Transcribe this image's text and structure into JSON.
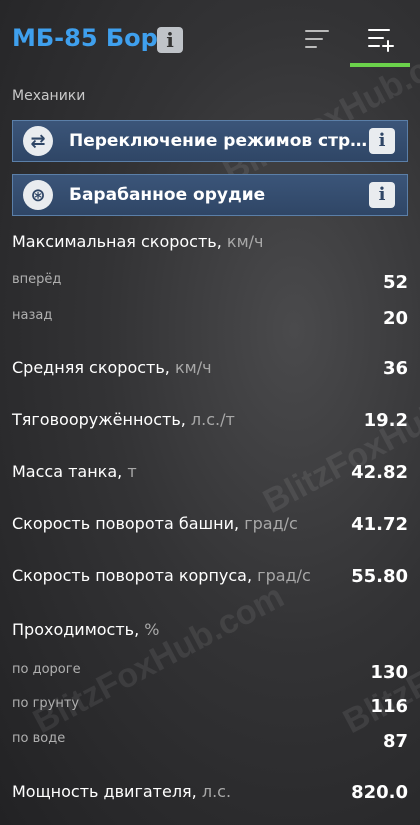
{
  "header": {
    "tank_name": "МБ-85 Бор",
    "info_glyph": "i"
  },
  "watermarks": {
    "text": "BlitzFoxHub.com"
  },
  "section": {
    "mechanics_label": "Механики"
  },
  "mechanics": [
    {
      "label": "Переключение режимов стр...",
      "icon": "mode-switch-icon",
      "info": "i"
    },
    {
      "label": "Барабанное орудие",
      "icon": "drum-gun-icon",
      "info": "i"
    }
  ],
  "stats": {
    "max_speed": {
      "label": "Максимальная скорость,",
      "unit": "км/ч"
    },
    "forward": {
      "label": "вперёд",
      "value": "52"
    },
    "reverse": {
      "label": "назад",
      "value": "20"
    },
    "avg_speed": {
      "label": "Средняя скорость,",
      "unit": "км/ч",
      "value": "36"
    },
    "power_ratio": {
      "label": "Тяговооружённость,",
      "unit": "л.с./т",
      "value": "19.2"
    },
    "mass": {
      "label": "Масса танка,",
      "unit": "т",
      "value": "42.82"
    },
    "turret_traverse": {
      "label": "Скорость поворота башни,",
      "unit": "град/с",
      "value": "41.72"
    },
    "hull_traverse": {
      "label": "Скорость поворота корпуса,",
      "unit": "град/с",
      "value": "55.80"
    },
    "terrain": {
      "label": "Проходимость,",
      "unit": "%"
    },
    "road": {
      "label": "по дороге",
      "value": "130"
    },
    "soil": {
      "label": "по грунту",
      "value": "116"
    },
    "water": {
      "label": "по воде",
      "value": "87"
    },
    "engine": {
      "label": "Мощность двигателя,",
      "unit": "л.с.",
      "value": "820.0"
    }
  }
}
